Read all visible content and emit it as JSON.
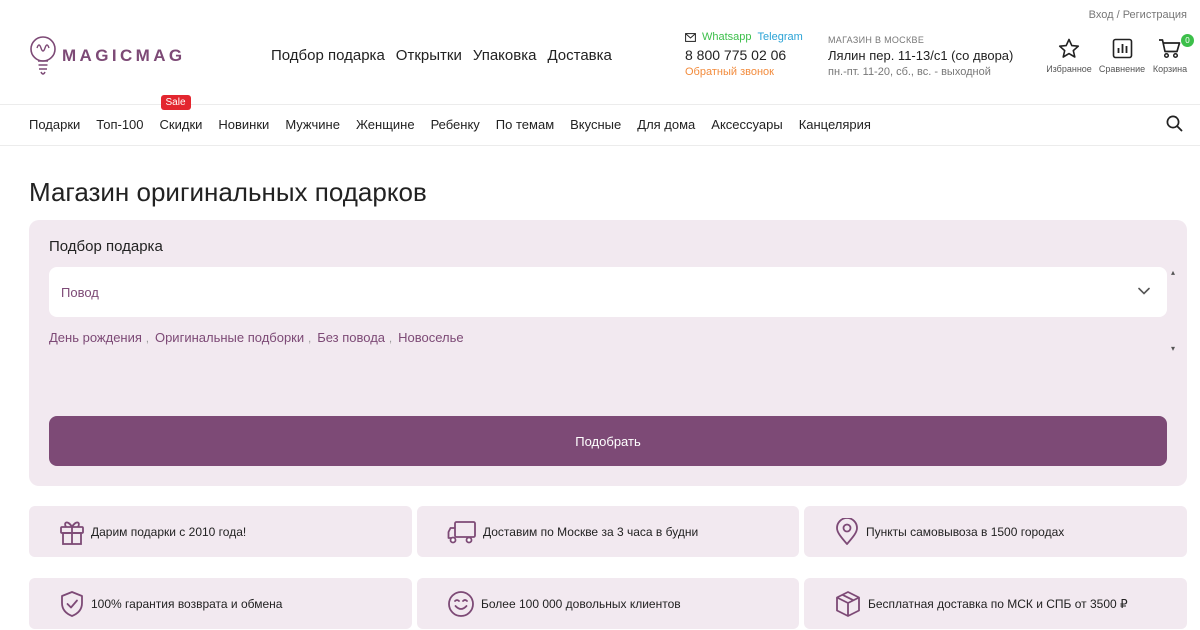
{
  "header": {
    "login": "Вход",
    "auth_sep": "/",
    "register": "Регистрация",
    "logo_text": "MAGICMAG",
    "nav": [
      "Подбор подарка",
      "Открытки",
      "Упаковка",
      "Доставка"
    ],
    "whatsapp": "Whatsapp",
    "telegram": "Telegram",
    "phone": "8 800 775 02 06",
    "callback": "Обратный звонок",
    "shop_label": "МАГАЗИН В МОСКВЕ",
    "shop_address": "Лялин пер. 11-13/с1 (со двора)",
    "shop_hours": "пн.-пт. 11-20, сб., вс. - выходной",
    "favorites": "Избранное",
    "compare": "Сравнение",
    "cart": "Корзина",
    "cart_count": "0"
  },
  "catnav": {
    "items": [
      "Подарки",
      "Топ-100",
      "Скидки",
      "Новинки",
      "Мужчине",
      "Женщине",
      "Ребенку",
      "По темам",
      "Вкусные",
      "Для дома",
      "Аксессуары",
      "Канцелярия"
    ],
    "sale_badge": "Sale"
  },
  "page_title": "Магазин оригинальных подарков",
  "gift_picker": {
    "title": "Подбор подарка",
    "select_placeholder": "Повод",
    "quick_links": [
      "День рождения",
      "Оригинальные подборки",
      "Без повода",
      "Новоселье"
    ],
    "link_sep": ",",
    "submit": "Подобрать"
  },
  "features": [
    {
      "icon": "gift-icon",
      "text": "Дарим подарки с 2010 года!"
    },
    {
      "icon": "truck-icon",
      "text": "Доставим по Москве за 3 часа в будни"
    },
    {
      "icon": "map-pin-icon",
      "text": "Пункты самовывоза в 1500 городах"
    },
    {
      "icon": "shield-check-icon",
      "text": "100% гарантия возврата и обмена"
    },
    {
      "icon": "smile-icon",
      "text": "Более 100 000 довольных клиентов"
    },
    {
      "icon": "box-icon",
      "text": "Бесплатная доставка по МСК и СПБ от 3500 ₽"
    }
  ],
  "colors": {
    "brand": "#7d4a76",
    "panel_bg": "#f2e9f0",
    "sale": "#e3262f",
    "whatsapp": "#3cbf4a",
    "telegram": "#2aa3d6",
    "callback": "#f28b3c"
  }
}
